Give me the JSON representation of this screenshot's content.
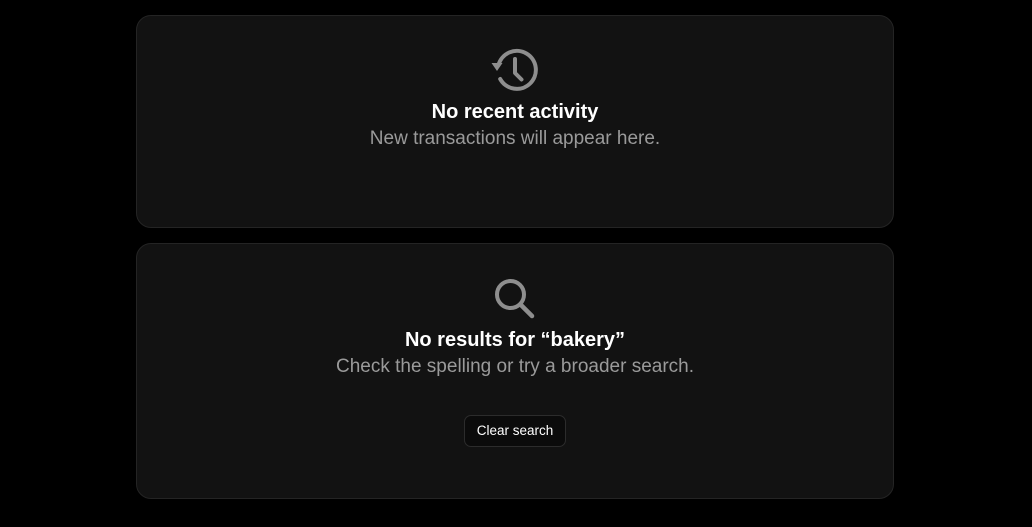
{
  "activity_card": {
    "icon": "history-icon",
    "title": "No recent activity",
    "subtitle": "New transactions will appear here."
  },
  "search_card": {
    "icon": "search-icon",
    "title": "No results for “bakery”",
    "subtitle": "Check the spelling or try a broader search.",
    "clear_button_label": "Clear search"
  },
  "colors": {
    "background": "#000000",
    "card_background": "#121212",
    "card_border": "#242424",
    "icon": "#8e8e8e",
    "title": "#ffffff",
    "subtitle": "#9a9a9a"
  }
}
